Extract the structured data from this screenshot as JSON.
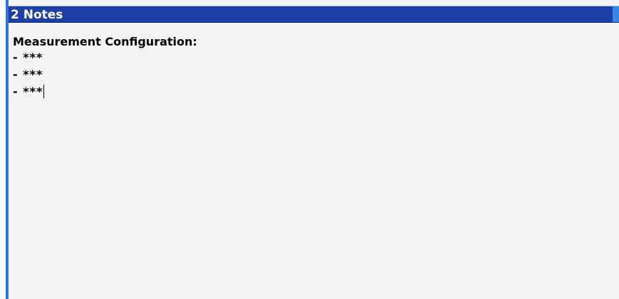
{
  "panel": {
    "title": "2 Notes"
  },
  "notes": {
    "heading": "Measurement Configuration:",
    "lines": [
      "- ***",
      "- ***",
      "- ***"
    ]
  }
}
